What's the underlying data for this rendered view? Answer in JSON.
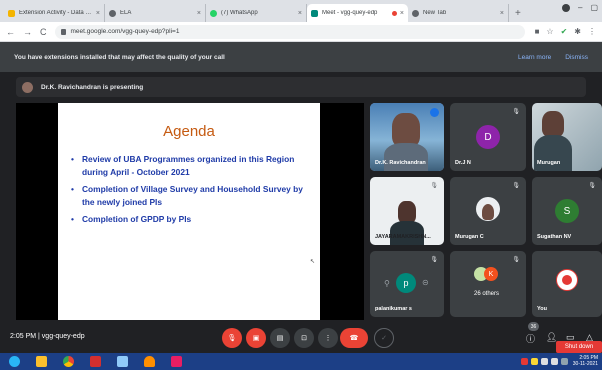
{
  "browser": {
    "tabs": [
      {
        "title": "Extension Activity - Data Temp",
        "favicon_color": "#f4b400"
      },
      {
        "title": "ELA",
        "favicon_color": "#5f6368"
      },
      {
        "title": "(7) WhatsApp",
        "favicon_color": "#25d366"
      },
      {
        "title": "Meet - vgg-quey-edp",
        "favicon_color": "#00897b"
      },
      {
        "title": "New Tab",
        "favicon_color": "#5f6368"
      }
    ],
    "url": "meet.google.com/vgg-quey-edp?pli=1"
  },
  "banner": {
    "message": "You have extensions installed that may affect the quality of your call",
    "learn_more": "Learn more",
    "dismiss": "Dismiss"
  },
  "presenting": {
    "text": "Dr.K. Ravichandran is presenting"
  },
  "slide": {
    "title": "Agenda",
    "bullets": [
      "Review of UBA Programmes organized in this Region during April - October 2021",
      "Completion of Village Survey and Household Survey by the newly joined PIs",
      "Completion of GPDP by PIs"
    ]
  },
  "participants": [
    {
      "name": "Dr.K. Ravichandran"
    },
    {
      "name": "Dr.J N",
      "initial": "D",
      "color": "#8e24aa"
    },
    {
      "name": "Murugan"
    },
    {
      "name": "JAYARAMAKRISHN..."
    },
    {
      "name": "Murugan C"
    },
    {
      "name": "Sugathan NV",
      "initial": "S",
      "color": "#2e7d32"
    },
    {
      "name": "palanikumar s",
      "initial": "p",
      "color": "#00897b"
    },
    {
      "name": "26 others",
      "initial": "K",
      "color": "#f4511e"
    },
    {
      "name": "You"
    }
  ],
  "bottom": {
    "time": "2:05 PM",
    "meeting_code": "vgg-quey-edp",
    "participant_count": "36",
    "shutdown": "Shut down"
  },
  "taskbar": {
    "time": "2:05 PM",
    "date": "30-11-2021"
  },
  "colors": {
    "accent": "#8ab4f8",
    "danger": "#ea4335",
    "slide_title": "#c55a11",
    "slide_text": "#1f3ba8"
  }
}
